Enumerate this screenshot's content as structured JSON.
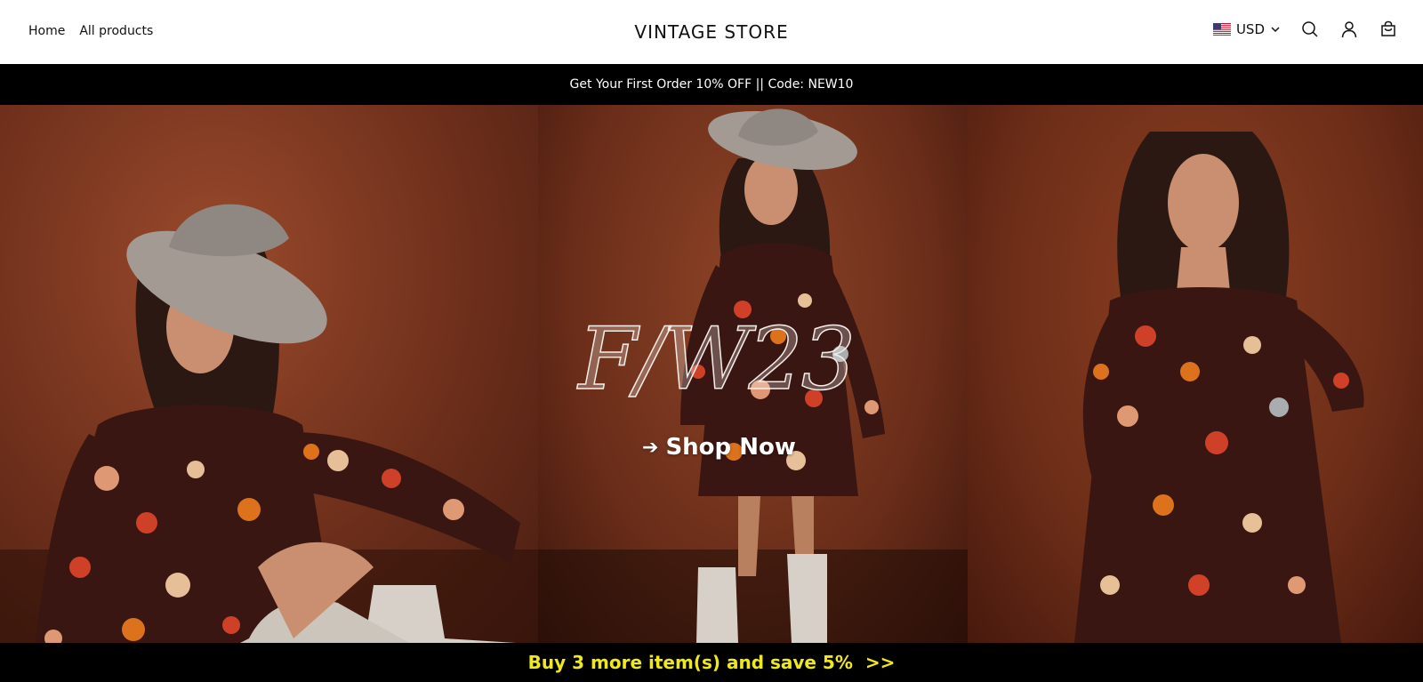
{
  "header": {
    "nav": {
      "home": "Home",
      "all_products": "All products"
    },
    "logo": "VINTAGE STORE",
    "currency": "USD"
  },
  "announcement": "Get Your First Order 10% OFF || Code: NEW10",
  "hero": {
    "title": "F/W23",
    "cta": "Shop Now",
    "cta_arrow": "➔"
  },
  "offer_bar": "Buy 3 more item(s) and save 5%  >>",
  "colors": {
    "accent_yellow": "#f0e91a",
    "bar_black": "#000000",
    "backdrop_rust": "#7a3620"
  },
  "icons": [
    "us-flag-icon",
    "chevron-down-icon",
    "search-icon",
    "account-icon",
    "cart-icon"
  ]
}
